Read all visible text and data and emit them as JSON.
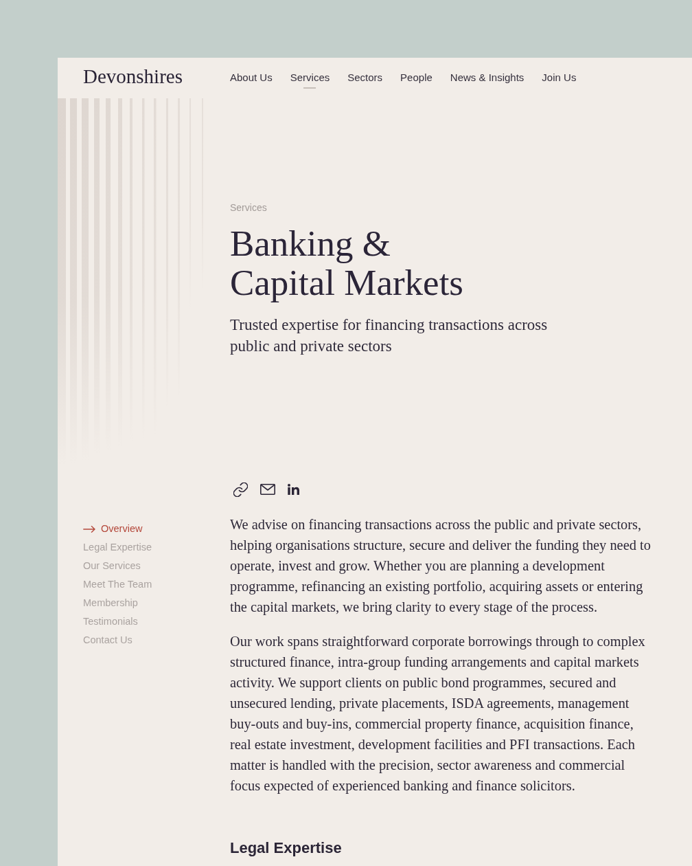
{
  "header": {
    "logo": "Devonshires",
    "nav": [
      {
        "label": "About Us",
        "selected": false
      },
      {
        "label": "Services",
        "selected": true
      },
      {
        "label": "Sectors",
        "selected": false
      },
      {
        "label": "People",
        "selected": false
      },
      {
        "label": "News & Insights",
        "selected": false
      },
      {
        "label": "Join Us",
        "selected": false
      }
    ]
  },
  "hero": {
    "eyebrow": "Services",
    "title": "Banking & Capital Markets",
    "subtitle": "Trusted expertise for financing transactions across public and private sectors"
  },
  "side_nav": [
    {
      "label": "Overview",
      "selected": true
    },
    {
      "label": "Legal Expertise",
      "selected": false
    },
    {
      "label": "Our Services",
      "selected": false
    },
    {
      "label": "Meet The Team",
      "selected": false
    },
    {
      "label": "Membership",
      "selected": false
    },
    {
      "label": "Testimonials",
      "selected": false
    },
    {
      "label": "Contact Us",
      "selected": false
    }
  ],
  "share_links": [
    {
      "kind": "link"
    },
    {
      "kind": "email"
    },
    {
      "kind": "linkedin"
    }
  ],
  "article": {
    "paragraphs": [
      "We advise on financing transactions across the public and private sectors, helping organisations structure, secure and deliver the funding they need to operate, invest and grow. Whether you are planning a development programme, refinancing an existing portfolio, acquiring assets or entering the capital markets, we bring clarity to every stage of the process.",
      "Our work spans straightforward corporate borrowings through to complex structured finance, intra-group funding arrangements and capital markets activity. We support clients on public bond programmes, secured and unsecured lending, private placements, ISDA agreements, management buy-outs and buy-ins, commercial property finance, acquisition finance, real estate investment, development facilities and PFI transactions. Each matter is handled with the precision, sector awareness and commercial focus expected of experienced banking and finance solicitors."
    ],
    "section_heading": "Legal Expertise"
  }
}
